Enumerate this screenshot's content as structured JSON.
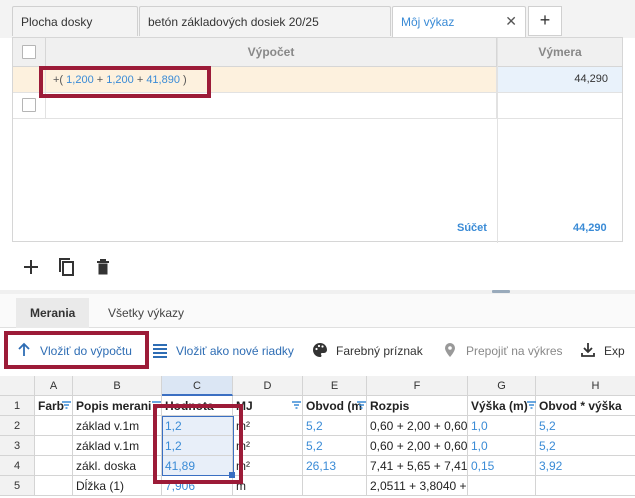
{
  "tabs": [
    {
      "label": "Plocha dosky",
      "active": false
    },
    {
      "label": "betón základových dosiek 20/25",
      "active": false
    },
    {
      "label": "Môj výkaz",
      "active": true
    }
  ],
  "tab_add_label": "+",
  "tab_close_label": "✕",
  "upper_grid": {
    "col_calc": "Výpočet",
    "col_amount": "Výmera",
    "rows": [
      {
        "formula_prefix": "+( ",
        "v1": "1,200",
        "op1": " + ",
        "v2": "1,200",
        "op2": " + ",
        "v3": "41,890",
        "suffix": " )",
        "amount": "44,290"
      }
    ],
    "sum_label": "Súčet",
    "sum_value": "44,290"
  },
  "lower_tabs": [
    {
      "label": "Merania",
      "active": true
    },
    {
      "label": "Všetky výkazy",
      "active": false
    }
  ],
  "actions": {
    "insert_calc": "Vložiť do výpočtu",
    "insert_rows": "Vložiť ako nové riadky",
    "color_flag": "Farebný príznak",
    "link_drawing": "Prepojiť na výkres",
    "export": "Exp"
  },
  "sheet": {
    "columns": [
      "A",
      "B",
      "C",
      "D",
      "E",
      "F",
      "G",
      "H"
    ],
    "row_numbers": [
      "1",
      "2",
      "3",
      "4",
      "5"
    ],
    "header_row": [
      "Farb",
      "Popis merani",
      "Hodnota",
      "MJ",
      "Obvod (m",
      "Rozpis",
      "Výška (m)",
      "Obvod * výška"
    ],
    "rows": [
      [
        "",
        "základ v.1m",
        "1,2",
        "m²",
        "5,2",
        "0,60 + 2,00 + 0,60",
        "1,0",
        "5,2"
      ],
      [
        "",
        "základ v.1m",
        "1,2",
        "m²",
        "5,2",
        "0,60 + 2,00 + 0,60",
        "1,0",
        "5,2"
      ],
      [
        "",
        "zákl. doska",
        "41,89",
        "m²",
        "26,13",
        "7,41 + 5,65 + 7,41",
        "0,15",
        "3,92"
      ],
      [
        "",
        "Dĺžka (1)",
        "7,906",
        "m",
        "",
        "2,0511 + 3,8040 +",
        "",
        ""
      ]
    ]
  },
  "colors": {
    "accent": "#3a8bd6",
    "highlight": "#9c1b38",
    "selected_row": "#fdf1de"
  }
}
